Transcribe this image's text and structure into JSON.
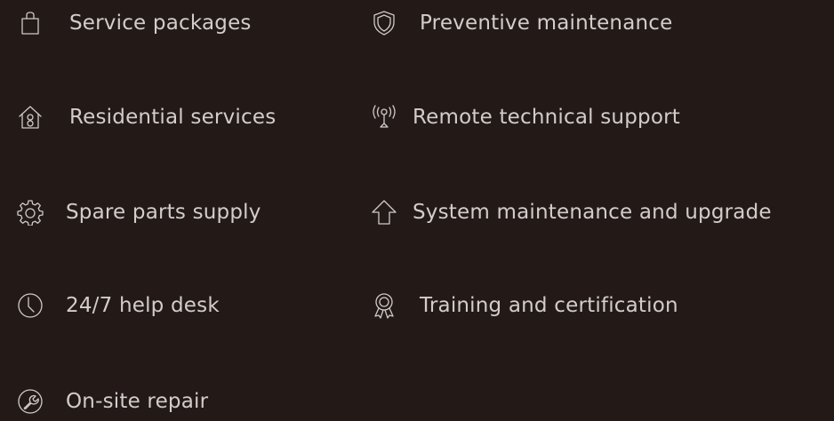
{
  "services": {
    "left": [
      {
        "icon": "shopping-bag-icon",
        "label": "Service packages"
      },
      {
        "icon": "home-icon",
        "label": "Residential services"
      },
      {
        "icon": "gear-icon",
        "label": "Spare parts supply"
      },
      {
        "icon": "clock-icon",
        "label": "24/7 help desk"
      },
      {
        "icon": "wrench-icon",
        "label": "On-site repair"
      }
    ],
    "right": [
      {
        "icon": "shield-icon",
        "label": "Preventive maintenance"
      },
      {
        "icon": "antenna-icon",
        "label": "Remote technical support"
      },
      {
        "icon": "arrow-up-icon",
        "label": "System maintenance and upgrade"
      },
      {
        "icon": "award-icon",
        "label": "Training and certification"
      }
    ]
  },
  "colors": {
    "background": "#231a18",
    "text": "#d2cdca",
    "icon_stroke": "#cfcac7"
  }
}
